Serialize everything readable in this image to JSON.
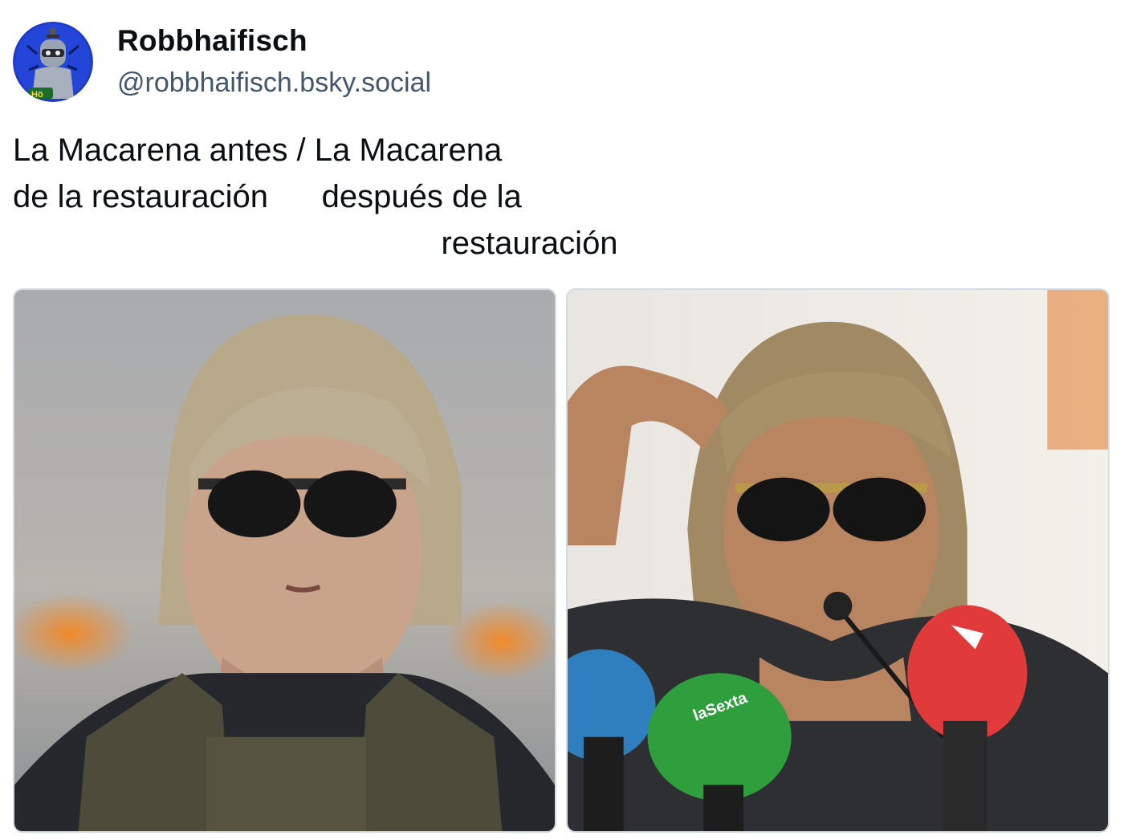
{
  "author": {
    "display_name": "Robbhaifisch",
    "handle": "@robbhaifisch.bsky.social",
    "avatar_icon": "robot-avatar-icon",
    "avatar_badge_text": "Hö"
  },
  "post": {
    "text": "La Macarena antes / La Macarena\nde la restauración      después de la\n                                                restauración"
  },
  "media": {
    "images": [
      {
        "name": "woman-sunglasses-photo",
        "description_icon": "photo-icon"
      },
      {
        "name": "man-sunglasses-microphones-photo",
        "description_icon": "photo-icon",
        "mic_label": "laSexta"
      }
    ]
  },
  "colors": {
    "handle": "#42576c",
    "avatar_bg": "#1f3cc9",
    "border": "#d4dbe2"
  }
}
